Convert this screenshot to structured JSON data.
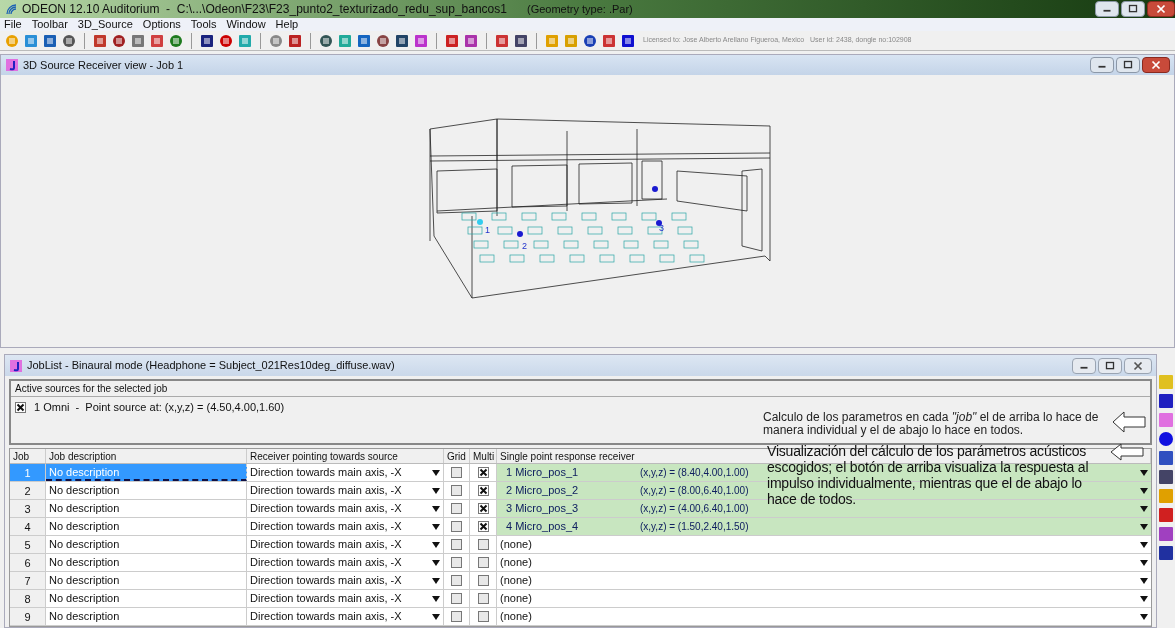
{
  "window": {
    "title": "ODEON 12.10 Auditorium  -  C:\\...\\Odeon\\F23\\F23_punto2_texturizado_redu_sup_bancos1",
    "geometry_type": "(Geometry type: .Par)"
  },
  "menu": [
    "File",
    "Toolbar",
    "3D_Source",
    "Options",
    "Tools",
    "Window",
    "Help"
  ],
  "license_text": "Licensed to: Jose Alberto Arellano Figueroa, Mexico   User id: 2438, dongle no:102908",
  "view_window": {
    "title": "3D Source Receiver view - Job 1",
    "receiver_markers": [
      "1",
      "2",
      "3"
    ]
  },
  "joblist": {
    "title": "JobList - Binaural mode (Headphone = Subject_021Res10deg_diffuse.wav)",
    "sources_group": {
      "label": "Active sources for the selected job",
      "sources": [
        {
          "text": "1 Omni  -  Point source at: (x,y,z) = (4.50,4.00,1.60)",
          "checked": true
        }
      ]
    },
    "notes": [
      "Calculo de los parametros en cada *\"job\"* el de arriba lo hace de manera individual y el de abajo lo hace en todos.",
      "Visualización del cálculo de los parámetros acústicos escogidos; el botón de arriba visualiza la respuesta al impulso individualmente, mientras que el de abajo lo hace de todos."
    ],
    "columns": [
      "Job",
      "Job description",
      "Receiver pointing towards source",
      "Grid",
      "Multi",
      "Single point response receiver"
    ],
    "rows": [
      {
        "job": "1",
        "description": "No description",
        "pointing": "Direction towards main axis, -X",
        "grid": false,
        "multi": true,
        "receiver": "1 Micro_pos_1",
        "coords": "(x,y,z) = (8.40,4.00,1.00)",
        "selected": true
      },
      {
        "job": "2",
        "description": "No description",
        "pointing": "Direction towards main axis, -X",
        "grid": false,
        "multi": true,
        "receiver": "2 Micro_pos_2",
        "coords": "(x,y,z) = (8.00,6.40,1.00)",
        "selected": false
      },
      {
        "job": "3",
        "description": "No description",
        "pointing": "Direction towards main axis, -X",
        "grid": false,
        "multi": true,
        "receiver": "3 Micro_pos_3",
        "coords": "(x,y,z) = (4.00,6.40,1.00)",
        "selected": false
      },
      {
        "job": "4",
        "description": "No description",
        "pointing": "Direction towards main axis, -X",
        "grid": false,
        "multi": true,
        "receiver": "4 Micro_pos_4",
        "coords": "(x,y,z) = (1.50,2.40,1.50)",
        "selected": false
      },
      {
        "job": "5",
        "description": "No description",
        "pointing": "Direction towards main axis, -X",
        "grid": false,
        "multi": false,
        "receiver": "(none)",
        "selected": false
      },
      {
        "job": "6",
        "description": "No description",
        "pointing": "Direction towards main axis, -X",
        "grid": false,
        "multi": false,
        "receiver": "(none)",
        "selected": false
      },
      {
        "job": "7",
        "description": "No description",
        "pointing": "Direction towards main axis, -X",
        "grid": false,
        "multi": false,
        "receiver": "(none)",
        "selected": false
      },
      {
        "job": "8",
        "description": "No description",
        "pointing": "Direction towards main axis, -X",
        "grid": false,
        "multi": false,
        "receiver": "(none)",
        "selected": false
      },
      {
        "job": "9",
        "description": "No description",
        "pointing": "Direction towards main axis, -X",
        "grid": false,
        "multi": false,
        "receiver": "(none)",
        "selected": false
      }
    ]
  }
}
